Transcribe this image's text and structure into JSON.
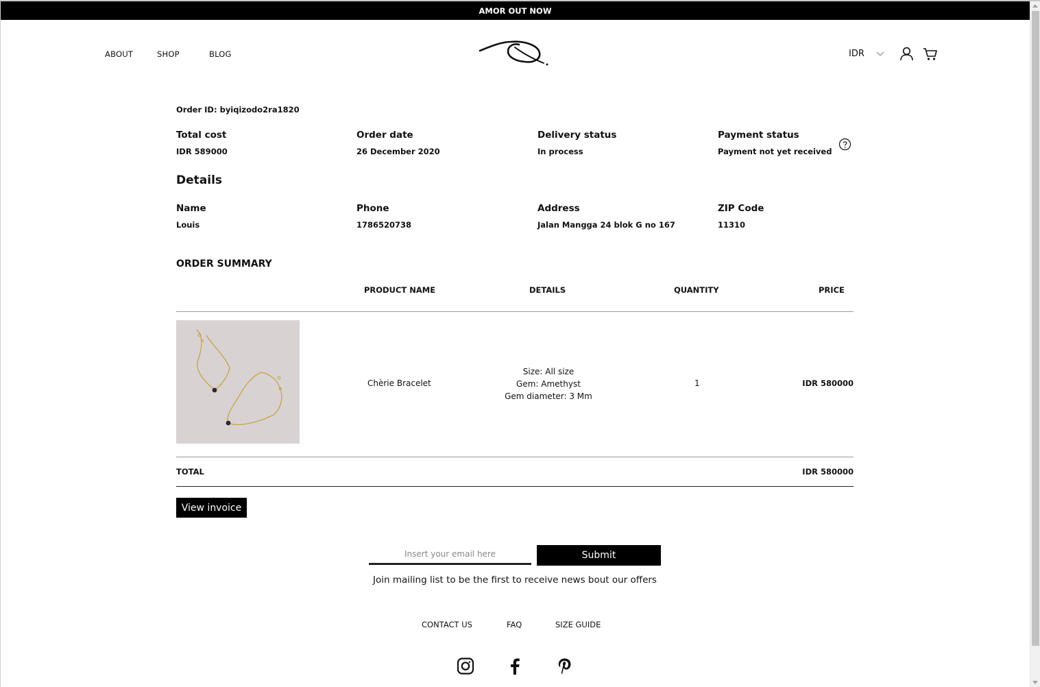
{
  "announcement": "AMOR OUT NOW",
  "nav": {
    "about": "ABOUT",
    "shop": "SHOP",
    "blog": "BLOG"
  },
  "header": {
    "currency": "IDR"
  },
  "order": {
    "id": "Order ID: byiqizodo2ra1820",
    "total_cost_label": "Total cost",
    "total_cost": "IDR 589000",
    "order_date_label": "Order date",
    "order_date": "26 December 2020",
    "delivery_status_label": "Delivery status",
    "delivery_status": "In process",
    "payment_status_label": "Payment status",
    "payment_status": "Payment not yet received"
  },
  "details": {
    "heading": "Details",
    "name_label": "Name",
    "name": "Louis",
    "phone_label": "Phone",
    "phone": "1786520738",
    "address_label": "Address",
    "address": "Jalan Mangga 24 blok G no 167",
    "zip_label": "ZIP Code",
    "zip": "11310"
  },
  "summary": {
    "heading": "ORDER SUMMARY",
    "columns": {
      "product": "PRODUCT NAME",
      "details": "DETAILS",
      "quantity": "QUANTITY",
      "price": "PRICE"
    },
    "items": [
      {
        "name": "Chèrie Bracelet",
        "details": [
          "Size: All size",
          "Gem: Amethyst",
          "Gem diameter: 3 Mm"
        ],
        "quantity": "1",
        "price": "IDR 580000"
      }
    ],
    "total_label": "TOTAL",
    "total": "IDR 580000",
    "invoice_button": "View invoice"
  },
  "newsletter": {
    "placeholder": "Insert your email here",
    "submit": "Submit",
    "text": "Join mailing list to be the first to receive news bout our offers"
  },
  "footer": {
    "contact": "CONTACT US",
    "faq": "FAQ",
    "size_guide": "SIZE GUIDE"
  },
  "icons": {
    "logo": "eye-leaf-logo",
    "user": "user-icon",
    "cart": "cart-icon",
    "help": "question-circle-icon",
    "instagram": "instagram-icon",
    "facebook": "facebook-icon",
    "pinterest": "pinterest-icon"
  },
  "colors": {
    "accent": "#000000",
    "background": "#ffffff",
    "text": "#111111"
  }
}
